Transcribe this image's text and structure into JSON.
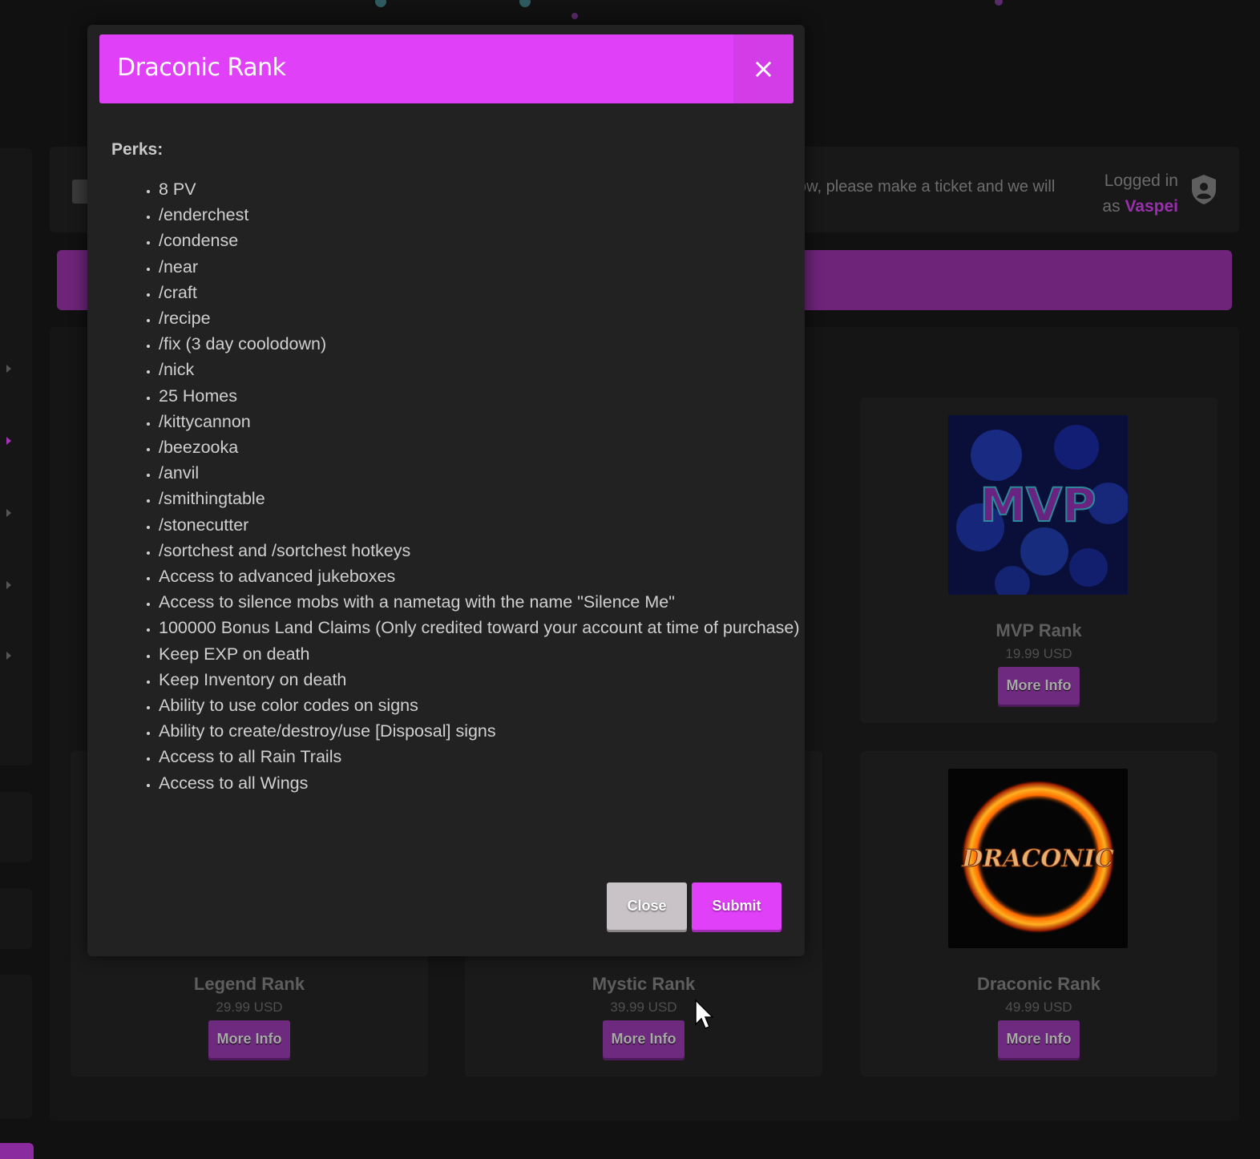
{
  "header": {
    "notice_text": "ow, please make a ticket and we will",
    "login_prefix": "Logged in",
    "login_as": "as",
    "username": "Vaspei"
  },
  "cards": [
    {
      "title": "MVP Rank",
      "price": "19.99 USD",
      "button": "More Info",
      "image_text": "MVP",
      "image": "mvp-rank-image"
    },
    {
      "title": "Legend Rank",
      "price": "29.99 USD",
      "button": "More Info"
    },
    {
      "title": "Mystic Rank",
      "price": "39.99 USD",
      "button": "More Info"
    },
    {
      "title": "Draconic Rank",
      "price": "49.99 USD",
      "button": "More Info",
      "image_text": "DRACONIC",
      "image": "draconic-rank-image"
    }
  ],
  "modal": {
    "title": "Draconic Rank",
    "close_symbol": "×",
    "perks_label": "Perks:",
    "perks": [
      "8 PV",
      "/enderchest",
      "/condense",
      "/near",
      "/craft",
      "/recipe",
      "/fix (3 day coolodown)",
      "/nick",
      "25 Homes",
      "/kittycannon",
      "/beezooka",
      "/anvil",
      "/smithingtable",
      "/stonecutter",
      "/sortchest and /sortchest hotkeys",
      "Access to advanced jukeboxes",
      "Access to silence mobs with a nametag with the name \"Silence Me\"",
      "100000 Bonus Land Claims (Only credited toward your account at time of purchase)",
      "Keep EXP on death",
      "Keep Inventory on death",
      "Ability to use color codes on signs",
      "Ability to create/destroy/use [Disposal] signs",
      "Access to all Rain Trails",
      "Access to all Wings"
    ],
    "close_button": "Close",
    "submit_button": "Submit"
  },
  "colors": {
    "accent": "#e040f8",
    "accent_dark": "#6e2a7e",
    "modal_bg": "#222222",
    "page_bg": "#111111"
  }
}
